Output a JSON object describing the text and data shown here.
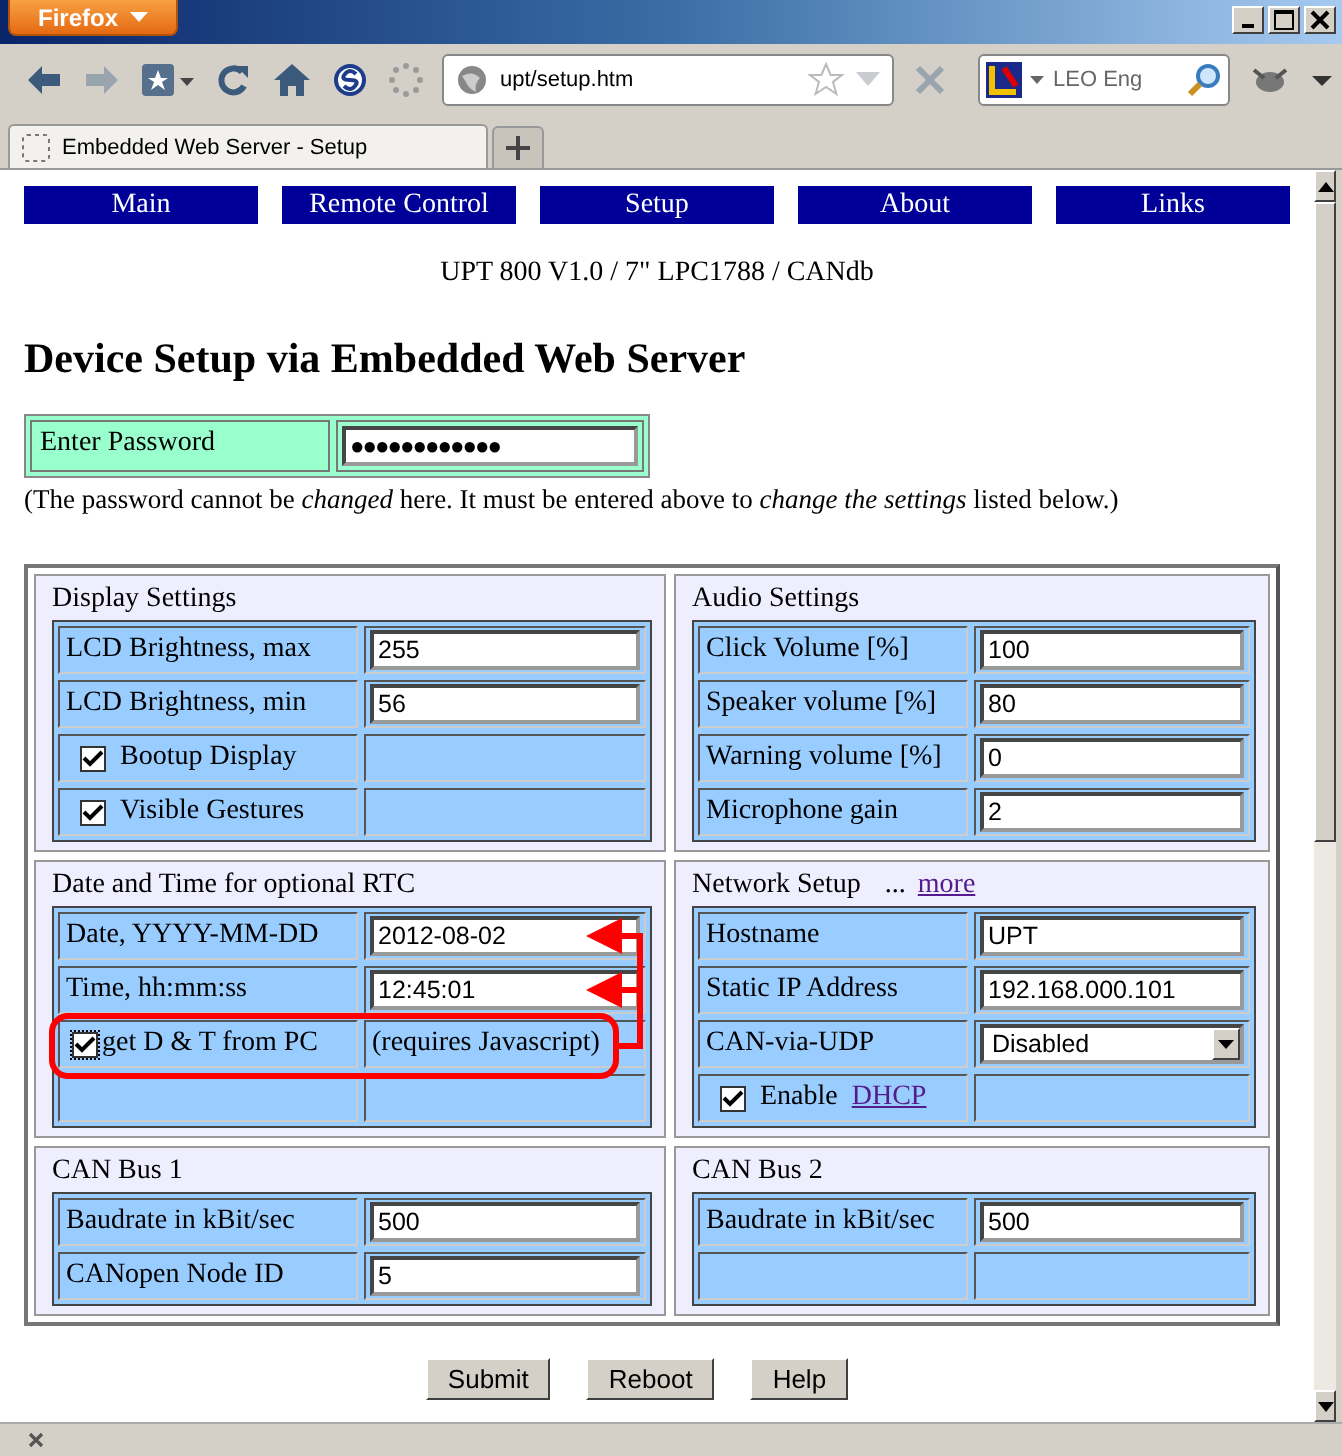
{
  "browser": {
    "menu_button": "Firefox",
    "address": "upt/setup.htm",
    "search_engine": "LEO Eng",
    "tabs": [
      {
        "title": "Embedded Web Server - Setup",
        "selected": true
      }
    ]
  },
  "nav_links": [
    "Main",
    "Remote Control",
    "Setup",
    "About",
    "Links"
  ],
  "subtitle": "UPT 800 V1.0 / 7\" LPC1788 / CANdb",
  "heading": "Device Setup via Embedded Web Server",
  "password": {
    "label": "Enter Password",
    "value": "●●●●●●●●●●●●"
  },
  "note": "(The password cannot be *changed* here. It must be entered above to *change the settings* listed below.)",
  "sections": [
    {
      "title": "Display Settings",
      "rows": [
        {
          "kind": "input",
          "label": "LCD Brightness, max",
          "value": "255"
        },
        {
          "kind": "input",
          "label": "LCD Brightness, min",
          "value": "56"
        },
        {
          "kind": "checkbox",
          "label": "Bootup Display",
          "checked": true
        },
        {
          "kind": "checkbox",
          "label": "Visible Gestures",
          "checked": true
        }
      ]
    },
    {
      "title": "Audio Settings",
      "rows": [
        {
          "kind": "input",
          "label": "Click Volume [%]",
          "value": "100"
        },
        {
          "kind": "input",
          "label": "Speaker volume [%]",
          "value": "80"
        },
        {
          "kind": "input",
          "label": "Warning volume [%]",
          "value": "0"
        },
        {
          "kind": "input",
          "label": "Microphone gain",
          "value": "2"
        }
      ]
    },
    {
      "title": "Date and Time for optional RTC",
      "rows": [
        {
          "kind": "input",
          "label": "Date, YYYY-MM-DD",
          "value": "2012-08-02"
        },
        {
          "kind": "input",
          "label": "Time, hh:mm:ss",
          "value": "12:45:01"
        },
        {
          "kind": "checkbox_note",
          "label": "get D & T from PC",
          "checked": true,
          "note": "(requires Javascript)",
          "highlighted": true
        },
        {
          "kind": "empty"
        }
      ]
    },
    {
      "title": "Network Setup",
      "link_prefix": "...",
      "link": "more",
      "rows": [
        {
          "kind": "input",
          "label": "Hostname",
          "value": "UPT"
        },
        {
          "kind": "input",
          "label": "Static IP Address",
          "value": "192.168.000.101"
        },
        {
          "kind": "select",
          "label": "CAN-via-UDP",
          "value": "Disabled"
        },
        {
          "kind": "checkbox_link",
          "label": "Enable",
          "link": "DHCP",
          "checked": true
        }
      ]
    },
    {
      "title": "CAN Bus 1",
      "rows": [
        {
          "kind": "input",
          "label": "Baudrate in kBit/sec",
          "value": "500"
        },
        {
          "kind": "input",
          "label": "CANopen Node ID",
          "value": "5"
        }
      ]
    },
    {
      "title": "CAN Bus 2",
      "rows": [
        {
          "kind": "input",
          "label": "Baudrate in kBit/sec",
          "value": "500"
        },
        {
          "kind": "empty"
        }
      ]
    }
  ],
  "buttons": [
    "Submit",
    "Reboot",
    "Help"
  ]
}
